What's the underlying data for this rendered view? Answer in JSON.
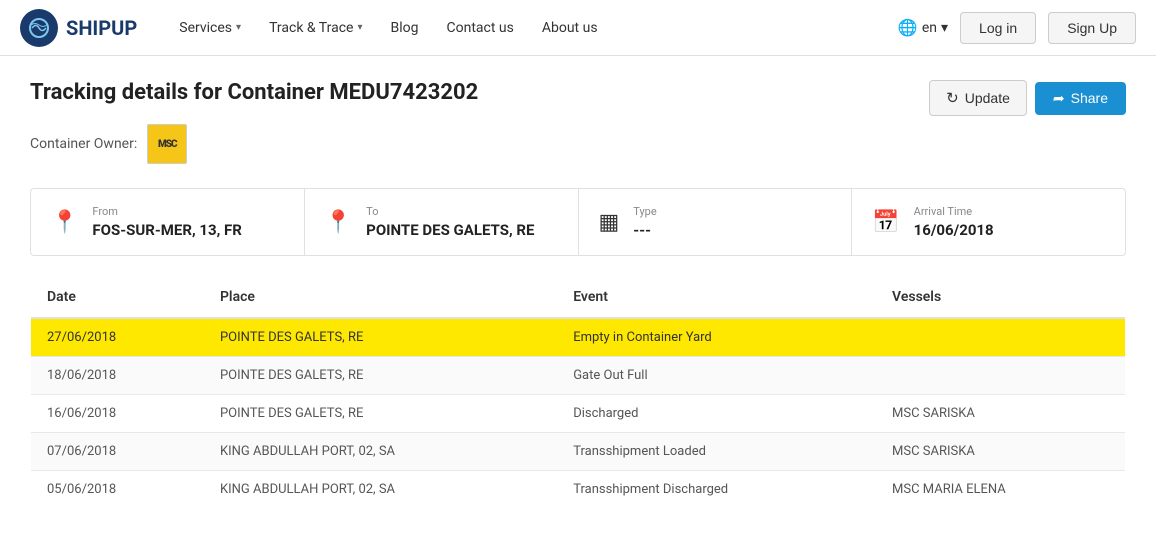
{
  "nav": {
    "logo_text": "SHIPUP",
    "links": [
      {
        "label": "Services",
        "has_dropdown": true
      },
      {
        "label": "Track & Trace",
        "has_dropdown": true
      },
      {
        "label": "Blog",
        "has_dropdown": false
      },
      {
        "label": "Contact us",
        "has_dropdown": false
      },
      {
        "label": "About us",
        "has_dropdown": false
      }
    ],
    "lang": "en",
    "login_label": "Log in",
    "signup_label": "Sign Up"
  },
  "page": {
    "title": "Tracking details for Container MEDU7423202",
    "container_owner_label": "Container Owner:",
    "owner_badge": "MSC",
    "update_label": "Update",
    "share_label": "Share",
    "from_label": "From",
    "from_value": "FOS-SUR-MER, 13, FR",
    "to_label": "To",
    "to_value": "POINTE DES GALETS, RE",
    "type_label": "Type",
    "type_value": "---",
    "arrival_label": "Arrival Time",
    "arrival_value": "16/06/2018",
    "table": {
      "headers": [
        "Date",
        "Place",
        "Event",
        "Vessels"
      ],
      "rows": [
        {
          "date": "27/06/2018",
          "place": "POINTE DES GALETS, RE",
          "event": "Empty in Container Yard",
          "vessel": "",
          "highlight": true
        },
        {
          "date": "18/06/2018",
          "place": "POINTE DES GALETS, RE",
          "event": "Gate Out Full",
          "vessel": "",
          "highlight": false
        },
        {
          "date": "16/06/2018",
          "place": "POINTE DES GALETS, RE",
          "event": "Discharged",
          "vessel": "MSC SARISKA",
          "highlight": false
        },
        {
          "date": "07/06/2018",
          "place": "KING ABDULLAH PORT, 02, SA",
          "event": "Transshipment Loaded",
          "vessel": "MSC SARISKA",
          "highlight": false
        },
        {
          "date": "05/06/2018",
          "place": "KING ABDULLAH PORT, 02, SA",
          "event": "Transshipment Discharged",
          "vessel": "MSC MARIA ELENA",
          "highlight": false
        }
      ]
    }
  }
}
